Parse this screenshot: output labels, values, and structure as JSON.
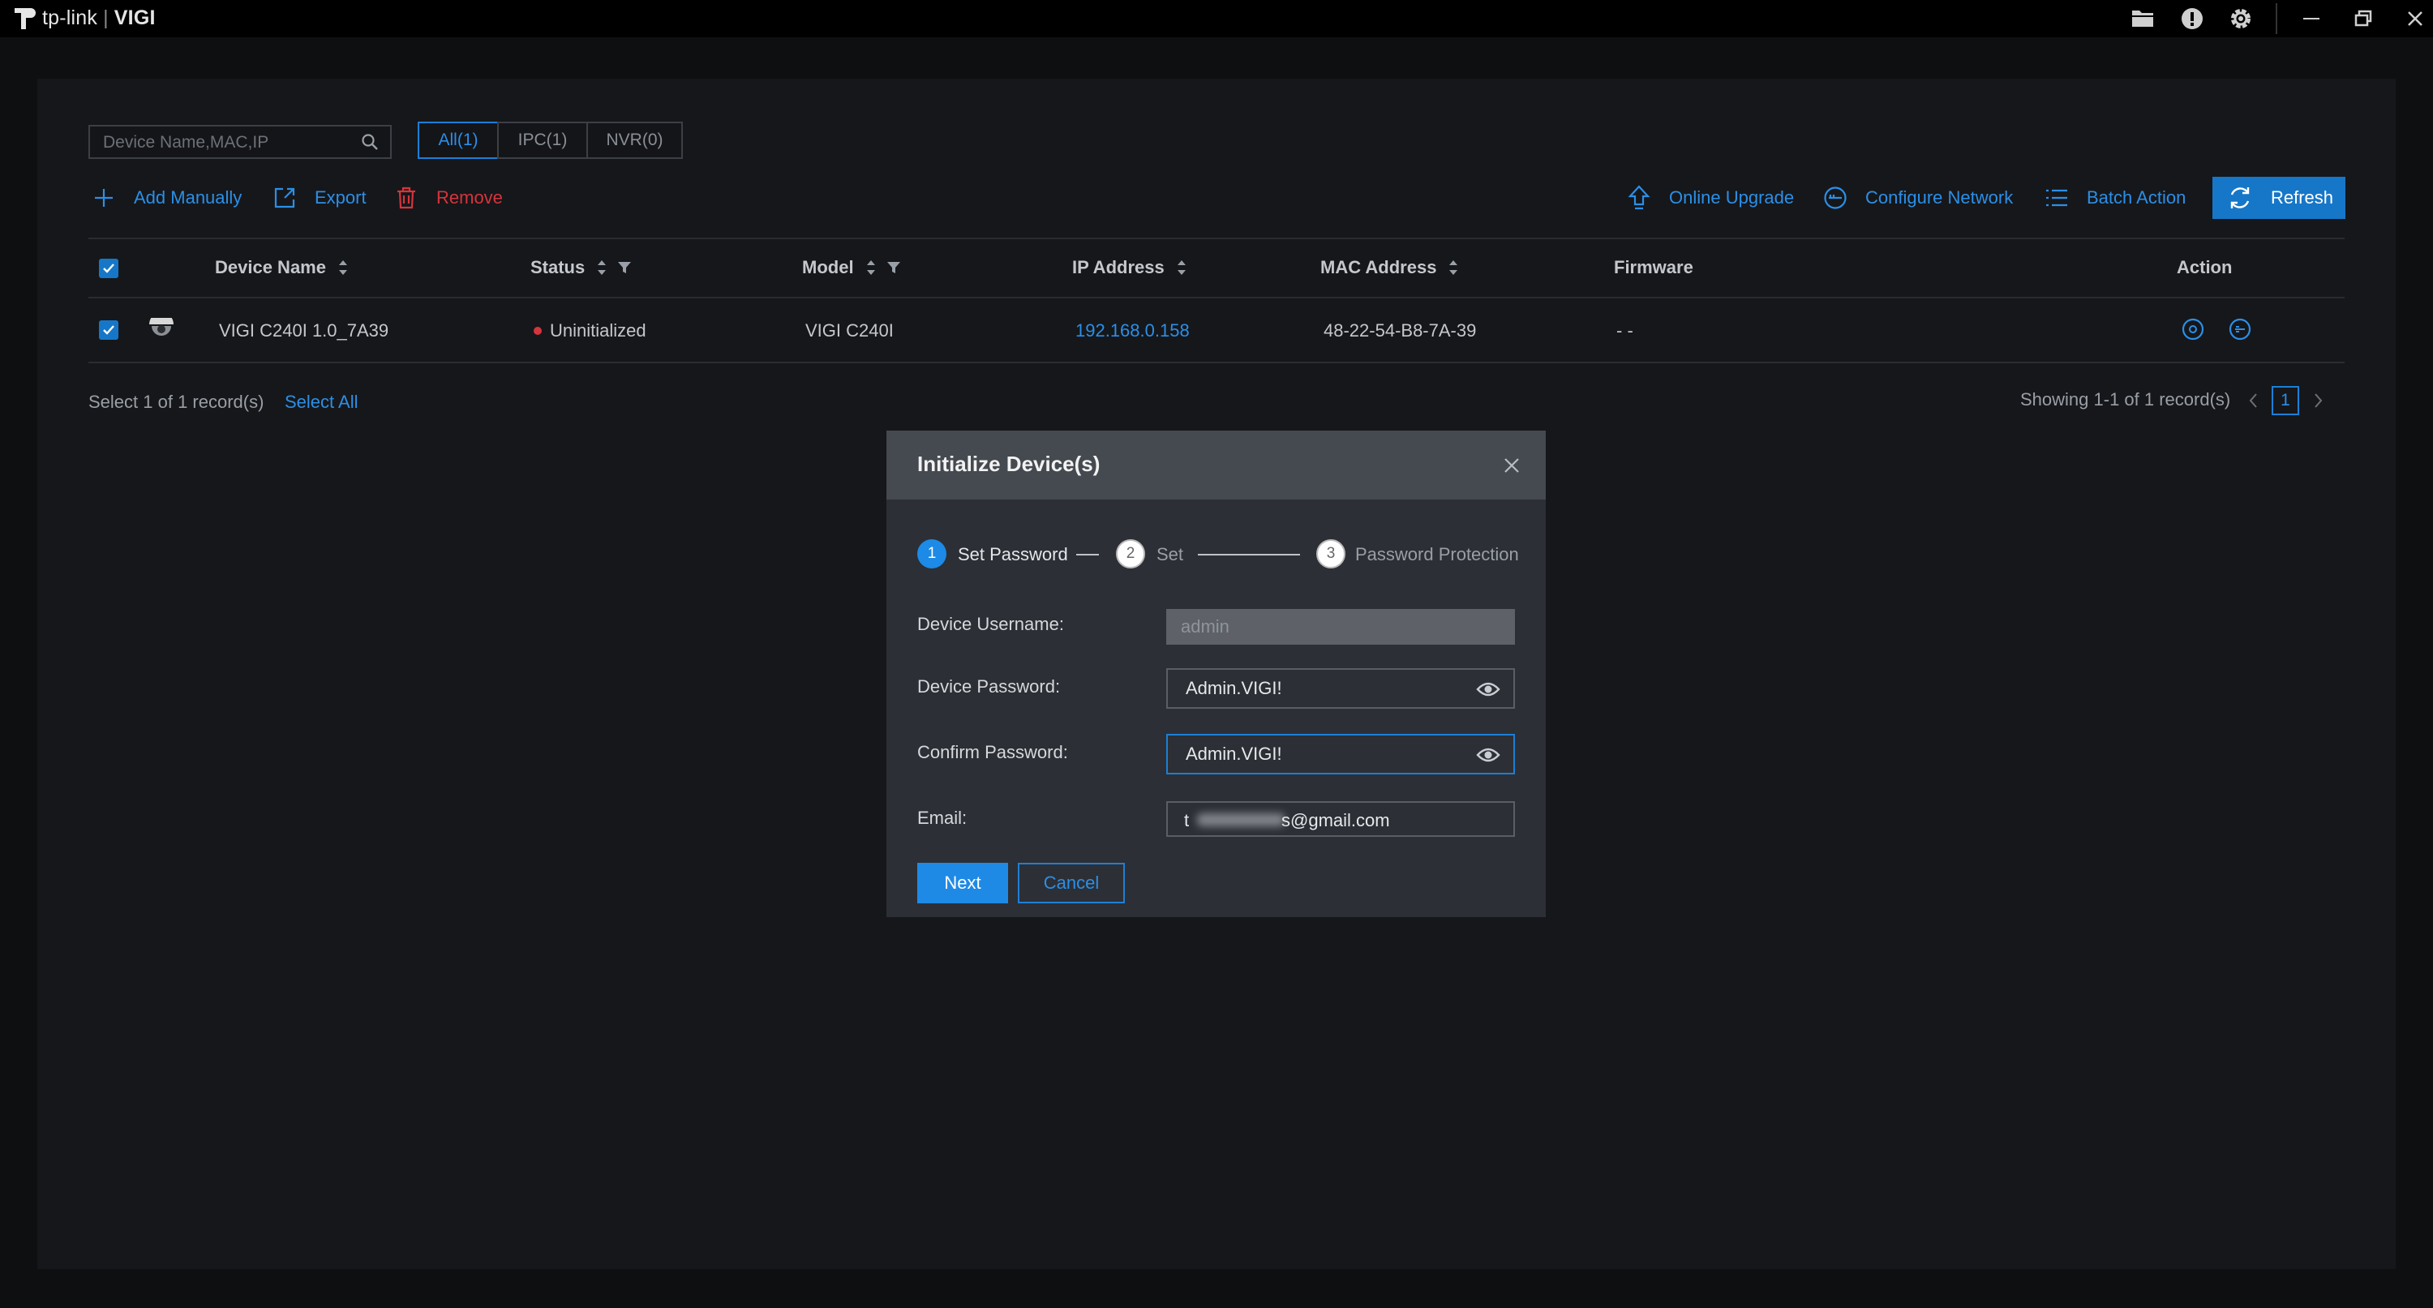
{
  "app": {
    "brand": "tp-link",
    "product": "VIGI"
  },
  "window_controls": [
    "folder-icon",
    "info-icon",
    "gear-icon",
    "minimize-icon",
    "restore-icon",
    "close-icon"
  ],
  "search": {
    "placeholder": "Device Name,MAC,IP",
    "value": ""
  },
  "filter_tabs": [
    {
      "label": "All(1)",
      "active": true
    },
    {
      "label": "IPC(1)",
      "active": false
    },
    {
      "label": "NVR(0)",
      "active": false
    }
  ],
  "toolbar": {
    "add_manually": "Add Manually",
    "export": "Export",
    "remove": "Remove",
    "online_upgrade": "Online Upgrade",
    "configure_network": "Configure Network",
    "batch_action": "Batch Action",
    "refresh": "Refresh"
  },
  "table": {
    "columns": {
      "device_name": "Device Name",
      "status": "Status",
      "model": "Model",
      "ip_address": "IP Address",
      "mac_address": "MAC Address",
      "firmware": "Firmware",
      "action": "Action"
    },
    "rows": [
      {
        "checked": true,
        "device_name": "VIGI C240I 1.0_7A39",
        "status": "Uninitialized",
        "model": "VIGI C240I",
        "ip_address": "192.168.0.158",
        "mac_address": "48-22-54-B8-7A-39",
        "firmware": "- -"
      }
    ]
  },
  "footer": {
    "selection": "Select 1 of 1 record(s)",
    "select_all": "Select All",
    "showing": "Showing 1-1 of 1 record(s)",
    "current_page": "1"
  },
  "modal": {
    "title": "Initialize Device(s)",
    "steps": [
      {
        "num": "1",
        "label": "Set Password",
        "active": true
      },
      {
        "num": "2",
        "label": "Set",
        "active": false
      },
      {
        "num": "3",
        "label": "Password Protection",
        "active": false
      }
    ],
    "fields": {
      "username_label": "Device Username:",
      "username_value": "admin",
      "password_label": "Device Password:",
      "password_value": "Admin.VIGI!",
      "confirm_label": "Confirm Password:",
      "confirm_value": "Admin.VIGI!",
      "email_label": "Email:",
      "email_prefix": "t",
      "email_suffix": "s@gmail.com"
    },
    "next": "Next",
    "cancel": "Cancel"
  },
  "colors": {
    "accent": "#1c7fd6",
    "danger": "#d6343c",
    "panel": "#16171a",
    "modal_header": "#454950"
  }
}
